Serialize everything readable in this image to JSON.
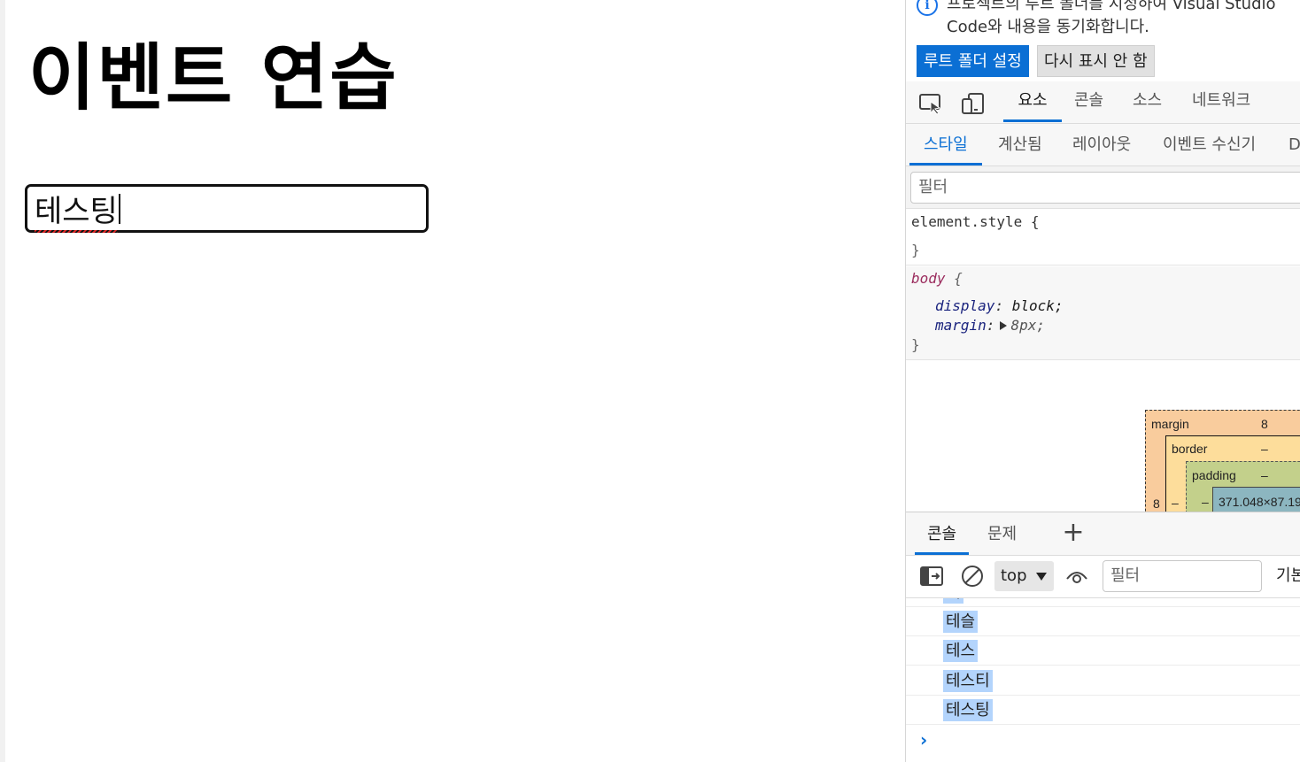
{
  "page": {
    "title": "이벤트 연습",
    "input_value": "테스팅"
  },
  "devtools": {
    "infobar": {
      "message": "프로젝트의 루트 폴더를 지정하여 Visual Studio Code와 내용을 동기화합니다.",
      "primary_button": "루트 폴더 설정",
      "secondary_button": "다시 표시 안 함",
      "icon": "info-icon"
    },
    "main_tabs": [
      {
        "label": "요소",
        "active": true
      },
      {
        "label": "콘솔",
        "active": false
      },
      {
        "label": "소스",
        "active": false
      },
      {
        "label": "네트워크",
        "active": false
      }
    ],
    "toolbar_icons": [
      "inspect-element-icon",
      "device-toolbar-icon"
    ],
    "styles_tabs": [
      {
        "label": "스타일",
        "active": true
      },
      {
        "label": "계산됨",
        "active": false
      },
      {
        "label": "레이아웃",
        "active": false
      },
      {
        "label": "이벤트 수신기",
        "active": false
      },
      {
        "label": "D",
        "active": false
      }
    ],
    "styles_filter_placeholder": "필터",
    "rules": {
      "element_selector": "element.style {",
      "element_close": "}",
      "body_selector": "body",
      "body_open": "{",
      "body_props": [
        {
          "name": "display",
          "value": "block;"
        },
        {
          "name": "margin",
          "value": "8px;"
        }
      ],
      "body_close": "}"
    },
    "box_model": {
      "margin_label": "margin",
      "margin_top": "8",
      "margin_left": "8",
      "border_label": "border",
      "border_top": "–",
      "border_left": "–",
      "padding_label": "padding",
      "padding_top": "–",
      "padding_left": "–",
      "content_size": "371.048×87.19"
    },
    "drawer_tabs": [
      {
        "label": "콘솔",
        "active": true
      },
      {
        "label": "문제",
        "active": false
      }
    ],
    "add_tab_symbol": "+",
    "console_toolbar": {
      "context": "top",
      "filter_placeholder": "필터",
      "levels": "기본"
    },
    "console_log": [
      "테",
      "테슬",
      "테스",
      "테스티",
      "테스팅"
    ],
    "prompt_symbol": "›"
  },
  "colors": {
    "accent": "#0b6fd4",
    "selection": "#b3d4fc",
    "box_margin": "#f9cc9d",
    "box_border": "#fddd9b",
    "box_padding": "#c3d08b",
    "box_content": "#8cb6c0"
  }
}
